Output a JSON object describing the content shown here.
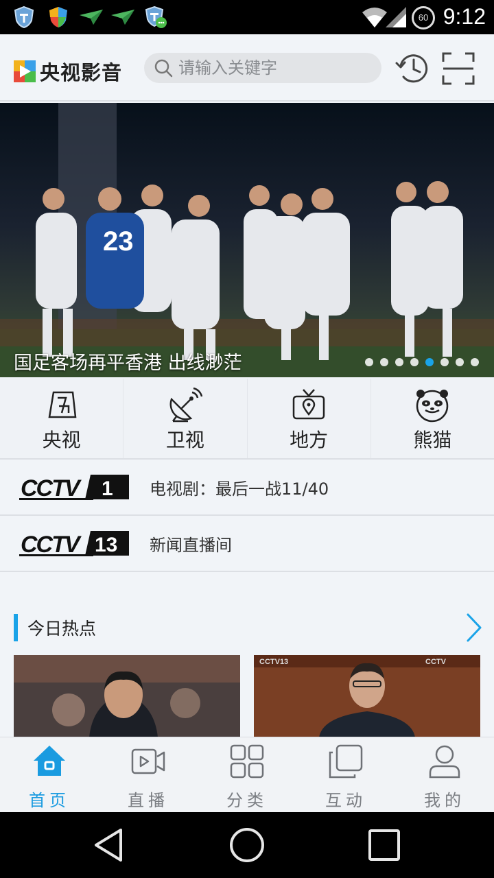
{
  "status_bar": {
    "time": "9:12",
    "battery": "60",
    "icons": [
      "shield-icon",
      "colored-shield-icon",
      "paper-plane-icon",
      "paper-plane-icon",
      "shield-chat-icon",
      "wifi-icon",
      "cell-signal-icon"
    ]
  },
  "header": {
    "app_name": "央视影音",
    "search_placeholder": "请输入关键字",
    "icons": [
      "history-clock-icon",
      "scan-icon"
    ]
  },
  "banner": {
    "caption": "国足客场再平香港 出线渺茫",
    "slide_count": 8,
    "active_slide": 4
  },
  "categories": [
    {
      "label": "央视",
      "icon": "cctv-icon"
    },
    {
      "label": "卫视",
      "icon": "satellite-dish-icon"
    },
    {
      "label": "地方",
      "icon": "tv-location-icon"
    },
    {
      "label": "熊猫",
      "icon": "panda-icon"
    }
  ],
  "channels": [
    {
      "logo": "CCTV1",
      "number": "1",
      "program": "电视剧：最后一战11/40"
    },
    {
      "logo": "CCTV13",
      "number": "13",
      "program": "新闻直播间"
    }
  ],
  "hot": {
    "title": "今日热点",
    "more_icon": "chevron-right-icon"
  },
  "tabs": [
    {
      "label": "首页",
      "icon": "home-icon",
      "active": true
    },
    {
      "label": "直播",
      "icon": "live-video-icon",
      "active": false
    },
    {
      "label": "分类",
      "icon": "grid-category-icon",
      "active": false
    },
    {
      "label": "互动",
      "icon": "interact-icon",
      "active": false
    },
    {
      "label": "我的",
      "icon": "user-icon",
      "active": false
    }
  ],
  "colors": {
    "accent": "#1a9be0",
    "background": "#f1f4f8",
    "status_bar": "#000000"
  }
}
